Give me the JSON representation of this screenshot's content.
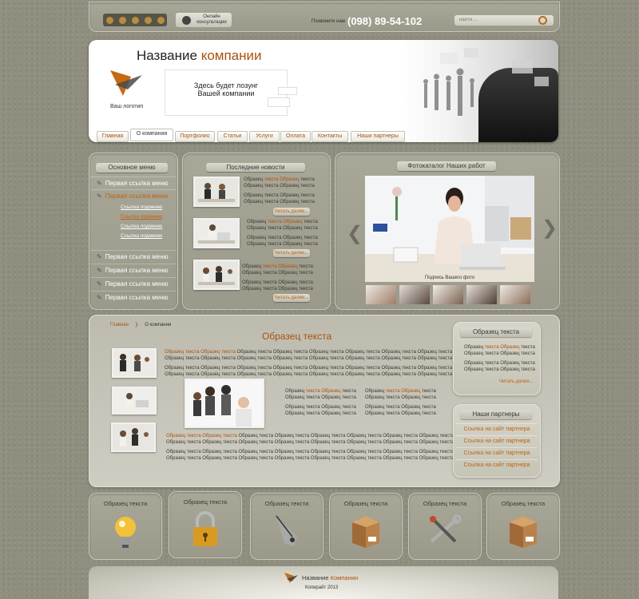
{
  "topbar": {
    "consult": "Онлайн консультации",
    "call_label": "Позвоните нам",
    "phone": "(098) 89-54-102",
    "search_placeholder": "найти ..."
  },
  "header": {
    "company_a": "Название",
    "company_b": "компании",
    "slogan_1": "Здесь будет лозунг",
    "slogan_2": "Вашей компании",
    "logo_caption": "Ваш логотип"
  },
  "nav": {
    "tabs": [
      "Главная",
      "О компании",
      "Портфолио",
      "Статьи",
      "Услуги",
      "Оплата",
      "Контакты",
      "Наши партнеры"
    ]
  },
  "sidebar": {
    "title": "Основное меню",
    "item1": "Первая ссылка меню",
    "item2": "Первая ссылка меню",
    "subs": [
      "Ссылка подменю",
      "Ссылка подменю",
      "Ссылка подменю",
      "Ссылка подменю"
    ],
    "items_rest": [
      "Первая ссылка меню",
      "Первая ссылка меню",
      "Первая ссылка меню",
      "Первая ссылка меню"
    ]
  },
  "news": {
    "title": "Последние новости",
    "line_hl": "Образец",
    "line_orange": "текста Образец",
    "line_plain": "текста",
    "body": "Образец текста Образец текста",
    "more": "Читать далее..."
  },
  "gallery": {
    "title": "Фотокаталог Наших работ",
    "caption": "Подпись Вашего фото"
  },
  "content": {
    "breadcrumb_home": "Главная",
    "breadcrumb_current": "О компании",
    "title": "Образец текста",
    "para_hl": "Образец текста Образец текста",
    "para_line": "Образец текста Образец текста Образец текста Образец текста Образец текста Образец текста Образец текста Образец текста",
    "short_1": "Образец",
    "short_2": "текста Образец",
    "short_3": "текста",
    "short_line": "Образец текста Образец текста"
  },
  "right": {
    "box1_title": "Образец текста",
    "box1_hl_a": "Образец",
    "box1_hl_b": "текста Образец",
    "box1_hl_c": "текста",
    "box1_line": "Образец текста Образец текста",
    "more": "Читать далее...",
    "partners_title": "Наши партнеры",
    "partners": [
      "Ссылка на сайт партнера",
      "Ссылка на сайт партнера",
      "Ссылка на сайт партнера",
      "Ссылка на сайт партнера"
    ]
  },
  "features": [
    "Образец текста",
    "Образец текста",
    "Образец текста",
    "Образец текста",
    "Образец текста",
    "Образец текста"
  ],
  "footer": {
    "name_a": "Название",
    "name_b": "Компании",
    "copyright": "Копирайт 2013"
  }
}
